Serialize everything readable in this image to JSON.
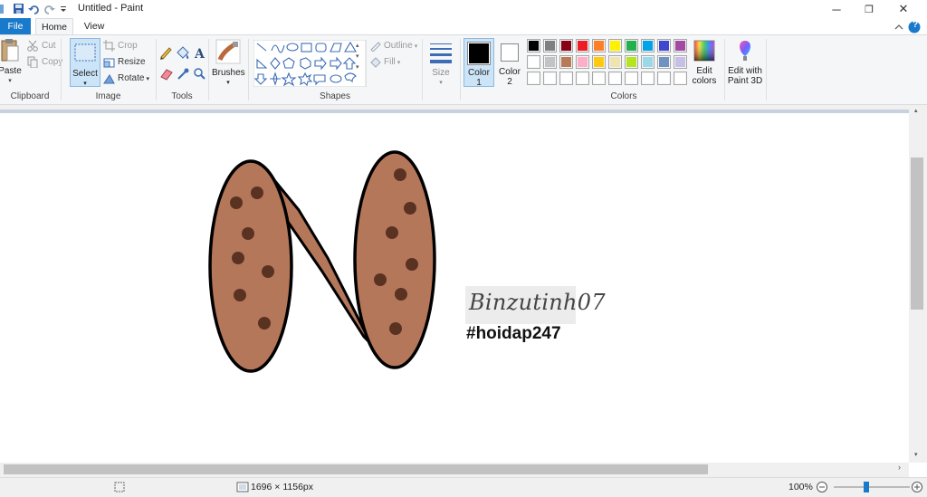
{
  "titlebar": {
    "title": "Untitled - Paint",
    "minimize_label": "─",
    "restore_label": "❐",
    "close_label": "✕",
    "help_label": "?"
  },
  "tabs": [
    {
      "label": "File",
      "color": "#1979ca"
    },
    {
      "label": "Home"
    },
    {
      "label": "View"
    }
  ],
  "ribbon": {
    "clipboard": {
      "label": "Clipboard",
      "paste_label": "Paste",
      "cut_label": "Cut",
      "copy_label": "Copy"
    },
    "image": {
      "label": "Image",
      "select_label": "Select",
      "crop_label": "Crop",
      "resize_label": "Resize",
      "rotate_label": "Rotate"
    },
    "tools": {
      "label": "Tools"
    },
    "brushes": {
      "label": "Brushes"
    },
    "shapes": {
      "label": "Shapes",
      "outline_label": "Outline",
      "fill_label": "Fill"
    },
    "size": {
      "label": "Size"
    },
    "color1": {
      "label_line1": "Color",
      "label_line2": "1",
      "value": "#000000"
    },
    "color2": {
      "label_line1": "Color",
      "label_line2": "2",
      "value": "#ffffff"
    },
    "colors": {
      "label": "Colors",
      "palette": [
        "#000000",
        "#7f7f7f",
        "#880015",
        "#ed1c24",
        "#ff7f27",
        "#fff200",
        "#22b14c",
        "#00a2e8",
        "#3f48cc",
        "#a349a4",
        "#ffffff",
        "#c3c3c3",
        "#b97a57",
        "#ffaec9",
        "#ffc90e",
        "#efe4b0",
        "#b5e61d",
        "#99d9ea",
        "#7092be",
        "#c8bfe7",
        "",
        "",
        "",
        "",
        "",
        "",
        "",
        "",
        "",
        ""
      ]
    },
    "edit_colors": {
      "line1": "Edit",
      "line2": "colors"
    },
    "paint3d": {
      "line1": "Edit with",
      "line2": "Paint 3D"
    }
  },
  "canvas": {
    "signature": "Binzutinh07",
    "hashtag": "#hoidap247",
    "fill_color": "#b5775a",
    "dot_color": "#5a3222"
  },
  "status": {
    "image_size": "1696 × 1156px",
    "zoom": "100%"
  }
}
